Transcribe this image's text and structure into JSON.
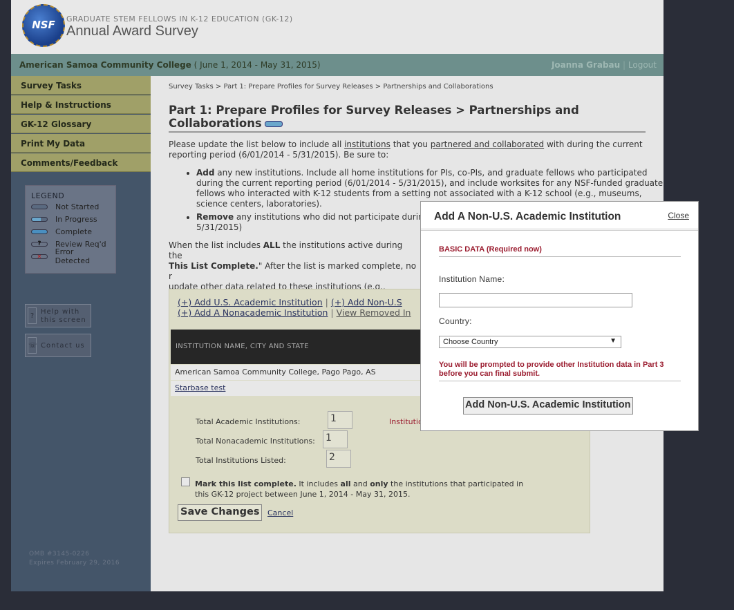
{
  "header": {
    "logo_text": "NSF",
    "subtitle": "GRADUATE STEM FELLOWS IN K-12 EDUCATION (GK-12)",
    "title": "Annual Award Survey"
  },
  "infobar": {
    "org": "American Samoa Community College",
    "period": "( June 1, 2014 - May 31, 2015)",
    "user": "Joanna Grabau",
    "sep": "|",
    "logout": "Logout"
  },
  "nav": [
    "Survey Tasks",
    "Help & Instructions",
    "GK-12 Glossary",
    "Print My Data",
    "Comments/Feedback"
  ],
  "legend": {
    "title": "LEGEND",
    "items": [
      {
        "label": "Not Started",
        "icon": "not-started-icon",
        "color": "#5a6a80"
      },
      {
        "label": "In Progress",
        "icon": "in-progress-icon",
        "color": "#6aa7cc"
      },
      {
        "label": "Complete",
        "icon": "complete-icon",
        "color": "#4a8fc0"
      },
      {
        "label": "Review Req'd",
        "icon": "review-icon",
        "glyph": "?"
      },
      {
        "label": "Error Detected",
        "icon": "error-icon",
        "glyph": "✕"
      }
    ]
  },
  "side_buttons": {
    "help_line1": "Help with",
    "help_line2": "this screen",
    "help_icon": "?",
    "contact": "Contact us",
    "contact_icon": "☏"
  },
  "omb": {
    "line1": "OMB #3145-0226",
    "line2": "Expires February 29, 2016"
  },
  "breadcrumb": "Survey Tasks > Part 1: Prepare Profiles for Survey Releases > Partnerships and Collaborations",
  "page_title": "Part 1: Prepare Profiles for Survey Releases > Partnerships and Collaborations",
  "intro": {
    "a": "Please update the list below to include all ",
    "link1": "institutions",
    "b": " that you ",
    "link2": "partnered and collaborated",
    "c": " with during the current reporting period (6/01/2014 - 5/31/2015). Be sure to:"
  },
  "bullets": {
    "b1_bold": "Add",
    "b1_text": " any new institutions. Include all home institutions for PIs, co-PIs, and graduate fellows who participated during the current reporting period (6/01/2014 - 5/31/2015), and include worksites for any NSF-funded graduate fellows who interacted with K-12 students from a setting not associated with a K-12 school (e.g., museums, science centers, laboratories).",
    "b2_bold": "Remove",
    "b2_text": " any institutions who did not participate durin",
    "b2_tail": "5/31/2015)"
  },
  "para2": {
    "a": "When the list includes ",
    "b": "ALL",
    "c": " the institutions active during the",
    "d": "This List Complete.",
    "e": "\" After the list is marked complete, no r",
    "f": "update other data related to these institutions (e.g., address)"
  },
  "panel": {
    "link_us": "(+) Add U.S. Academic Institution",
    "sep": "|",
    "link_nonus": "(+) Add Non-U.S",
    "link_nonacad": "(+) Add A Nonacademic Institution",
    "link_removed": "View Removed In",
    "table_header": "INSTITUTION NAME, CITY AND STATE",
    "rows": [
      "American Samoa Community College, Pago Pago, AS",
      "Starbase  test"
    ],
    "total_academic_label": "Total Academic Institutions:",
    "total_academic": "1",
    "total_nonacademic_label": "Total Nonacademic Institutions:",
    "total_nonacademic": "1",
    "total_listed_label": "Total Institutions Listed:",
    "total_listed": "2",
    "partial_red": "Institutio",
    "mark_bold": "Mark this list complete.",
    "mark_a": " It includes ",
    "mark_all": "all",
    "mark_b": " and ",
    "mark_only": "only",
    "mark_c": " the institutions that participated in this GK-12 project between June 1, 2014 - May 31, 2015.",
    "save": "Save Changes",
    "cancel": "Cancel"
  },
  "modal": {
    "title": "Add A Non-U.S. Academic Institution",
    "close": "Close",
    "section": "BASIC DATA (Required now)",
    "name_label": "Institution Name:",
    "name_value": "",
    "country_label": "Country:",
    "country_selected": "Choose Country",
    "note": "You will be prompted to provide other Institution data in Part 3 before you can final submit.",
    "submit": "Add Non-U.S. Academic Institution"
  },
  "colors": {
    "accent_red": "#9a1b2e",
    "nav_bg": "#a0a068",
    "infobar_bg": "#6d8f8c",
    "sidebar_bg": "#445569"
  }
}
